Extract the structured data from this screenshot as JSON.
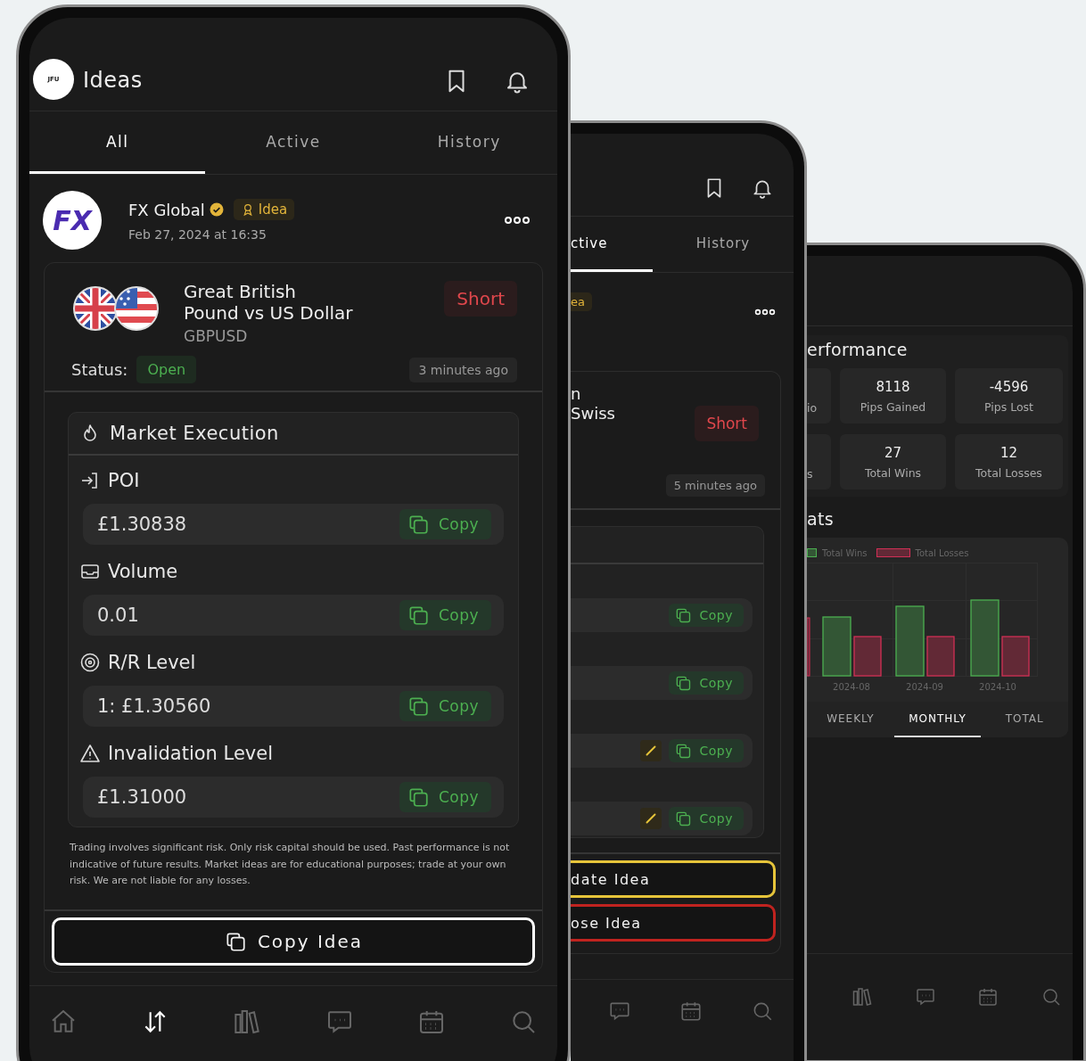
{
  "main_phone": {
    "logo_text": "JFU",
    "title": "Ideas",
    "tabs": [
      {
        "label": "All",
        "selected": true
      },
      {
        "label": "Active",
        "selected": false
      },
      {
        "label": "History",
        "selected": false
      }
    ],
    "post": {
      "author_logo": "FX",
      "author": "FX Global",
      "verified": true,
      "badge": "Idea",
      "date": "Feb 27, 2024 at 16:35"
    },
    "idea": {
      "title_lines": [
        "Great British",
        "Pound vs US Dollar"
      ],
      "symbol": "GBPUSD",
      "direction": {
        "label": "Short",
        "kind": "short"
      },
      "status_label": "Status:",
      "status": {
        "label": "Open",
        "kind": "open"
      },
      "age": "3 minutes ago",
      "section_title": "Market Execution",
      "fields": [
        {
          "kind": "poi",
          "label": "POI",
          "value": "£1.30838",
          "copy": "Copy"
        },
        {
          "kind": "volume",
          "label": "Volume",
          "value": "0.01",
          "copy": "Copy"
        },
        {
          "kind": "rr",
          "label": "R/R Level",
          "value": "1: £1.30560",
          "copy": "Copy"
        },
        {
          "kind": "invalidation",
          "label": "Invalidation Level",
          "value": "£1.31000",
          "copy": "Copy"
        }
      ],
      "disclaimer": "Trading involves significant risk. Only risk capital should be used. Past performance is not indicative of future results. Market ideas are for educational purposes; trade at your own risk. We are not liable for any losses.",
      "copy_button": "Copy Idea"
    },
    "nav": [
      {
        "kind": "home",
        "selected": false
      },
      {
        "kind": "trades",
        "selected": true
      },
      {
        "kind": "library",
        "selected": false
      },
      {
        "kind": "chat",
        "selected": false
      },
      {
        "kind": "calendar",
        "selected": false
      },
      {
        "kind": "search",
        "selected": false
      }
    ]
  },
  "middle_phone": {
    "tabs": [
      {
        "label": "ctive",
        "selected": true
      },
      {
        "label": "History",
        "selected": false
      }
    ],
    "badge": "ea",
    "title_lines": [
      "n",
      "Swiss"
    ],
    "direction": {
      "label": "Short",
      "kind": "short"
    },
    "age": "5 minutes ago",
    "fields": [
      {
        "copy": "Copy",
        "editable": false
      },
      {
        "copy": "Copy",
        "editable": false
      },
      {
        "copy": "Copy",
        "editable": true
      },
      {
        "copy": "Copy",
        "editable": true
      }
    ],
    "buttons": [
      {
        "kind": "update",
        "label": "date Idea"
      },
      {
        "kind": "close",
        "label": "ose Idea"
      }
    ],
    "nav": [
      {
        "kind": "chat",
        "selected": false
      },
      {
        "kind": "calendar",
        "selected": false
      },
      {
        "kind": "search",
        "selected": false
      }
    ]
  },
  "back_phone": {
    "heading": "erformance",
    "stats": [
      {
        "label": "io"
      },
      {
        "value": "8118",
        "label": "Pips Gained"
      },
      {
        "value": "-4596",
        "label": "Pips Lost"
      },
      {
        "label": "s"
      },
      {
        "value": "27",
        "label": "Total Wins"
      },
      {
        "value": "12",
        "label": "Total Losses"
      }
    ],
    "chart_heading": "ats",
    "chart": {
      "legend": [
        {
          "label": "Total Wins",
          "color": "#4caf50"
        },
        {
          "label": "Total Losses",
          "color": "#d12f55"
        }
      ],
      "x_labels": [
        "2024-08",
        "2024-09",
        "2024-10"
      ]
    },
    "tabs": [
      {
        "label": "WEEKLY",
        "selected": false
      },
      {
        "label": "MONTHLY",
        "selected": true
      },
      {
        "label": "TOTAL",
        "selected": false
      }
    ],
    "nav": [
      {
        "kind": "library",
        "selected": false
      },
      {
        "kind": "chat",
        "selected": false
      },
      {
        "kind": "calendar",
        "selected": false
      },
      {
        "kind": "search",
        "selected": false
      }
    ]
  }
}
